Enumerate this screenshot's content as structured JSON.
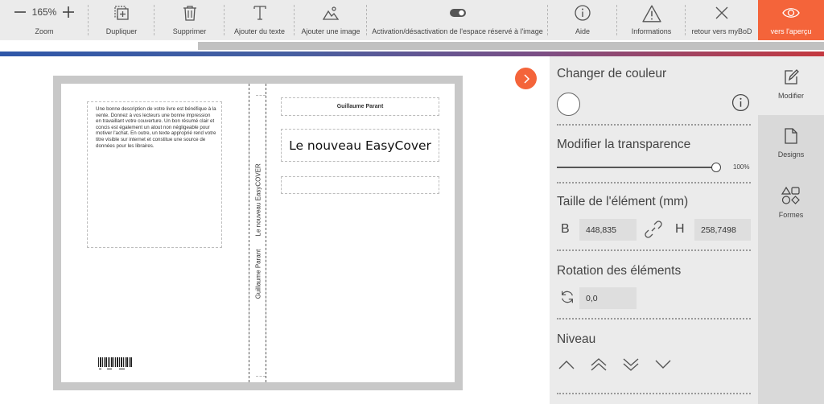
{
  "toolbar": {
    "zoom": {
      "value": "165%",
      "label": "Zoom",
      "minus_icon": "minus-icon",
      "plus_icon": "plus-icon"
    },
    "duplicate_label": "Dupliquer",
    "delete_label": "Supprimer",
    "add_text_label": "Ajouter du texte",
    "add_image_label": "Ajouter une image",
    "toggle_image_space_label": "Activation/désactivation de l'espace réservé à l'image",
    "help_label": "Aide",
    "information_label": "Informations",
    "back_label": "retour vers myBoD",
    "preview_label": "vers l'aperçu",
    "accent_color": "#f4643a"
  },
  "cover": {
    "back_text": "Une bonne description de votre livre est bénéfique à la vente. Donnez à vos lecteurs une bonne impression en travaillant votre couverture. Un bon résumé clair et concis est également un atout non négligeable pour motiver l'achat. En outre, un texte approprié rend votre titre visible sur internet et constitue une source de données pour les libraires.",
    "spine_title": "Le nouveau EasyCOVER",
    "spine_author": "Guillaume Parant",
    "front_author": "Guillaume Parant",
    "front_title": "Le nouveau EasyCover"
  },
  "panel": {
    "color_title": "Changer de couleur",
    "swatch_color": "#ffffff",
    "transparency_title": "Modifier la transparence",
    "transparency_value": "100%",
    "transparency_fraction": 1.0,
    "size_title": "Taille de l'élément (mm)",
    "width_label": "B",
    "width_value": "448,835",
    "height_label": "H",
    "height_value": "258,7498",
    "rotation_title": "Rotation des éléments",
    "rotation_value": "0,0",
    "level_title": "Niveau"
  },
  "sidetabs": [
    {
      "label": "Modifier",
      "icon": "edit-icon",
      "active": true
    },
    {
      "label": "Designs",
      "icon": "document-icon",
      "active": false
    },
    {
      "label": "Formes",
      "icon": "shapes-icon",
      "active": false
    }
  ]
}
